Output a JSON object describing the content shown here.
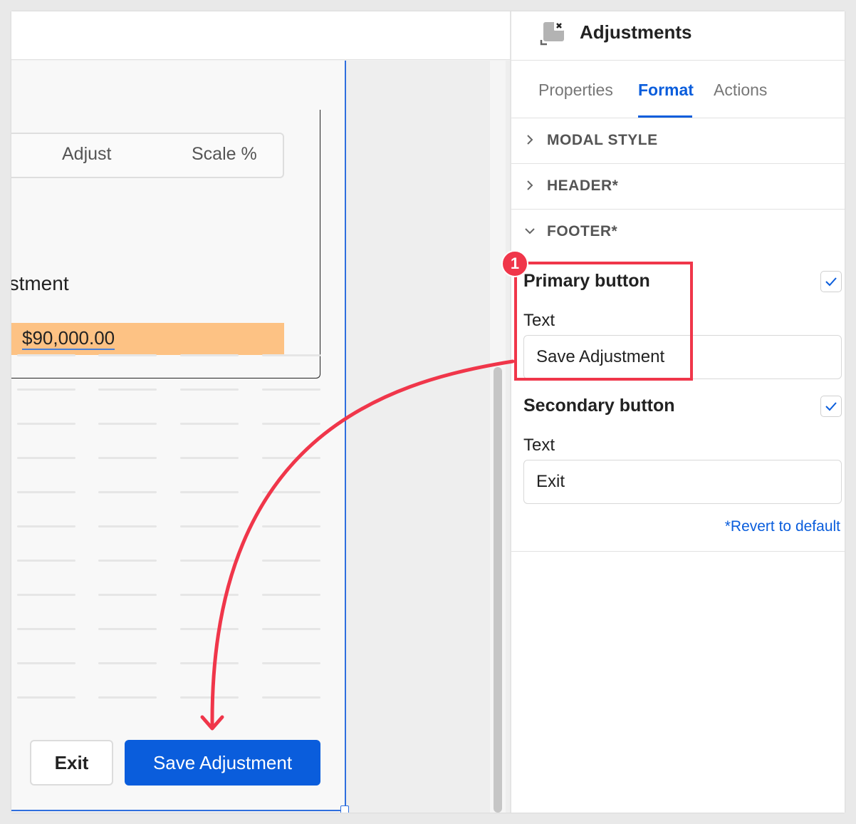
{
  "canvas": {
    "tabs": [
      "Adjust",
      "Scale %"
    ],
    "adjustment_label": "ustment",
    "amount": "$90,000.00",
    "footer": {
      "exit_label": "Exit",
      "save_label": "Save Adjustment"
    }
  },
  "panel": {
    "title": "Adjustments",
    "tabs": {
      "properties": "Properties",
      "format": "Format",
      "actions": "Actions"
    },
    "active_tab": "Format",
    "sections": {
      "modal_style": "MODAL STYLE",
      "header": "HEADER*",
      "footer": "FOOTER*"
    },
    "primary_button": {
      "title": "Primary button",
      "text_label": "Text",
      "text_value": "Save Adjustment",
      "enabled": true
    },
    "secondary_button": {
      "title": "Secondary button",
      "text_label": "Text",
      "text_value": "Exit",
      "enabled": true
    },
    "revert_label": "*Revert to default"
  },
  "annotation": {
    "badge": "1"
  },
  "colors": {
    "accent": "#0a5ddc",
    "highlight": "#fdc284",
    "annotation": "#f0364a"
  }
}
